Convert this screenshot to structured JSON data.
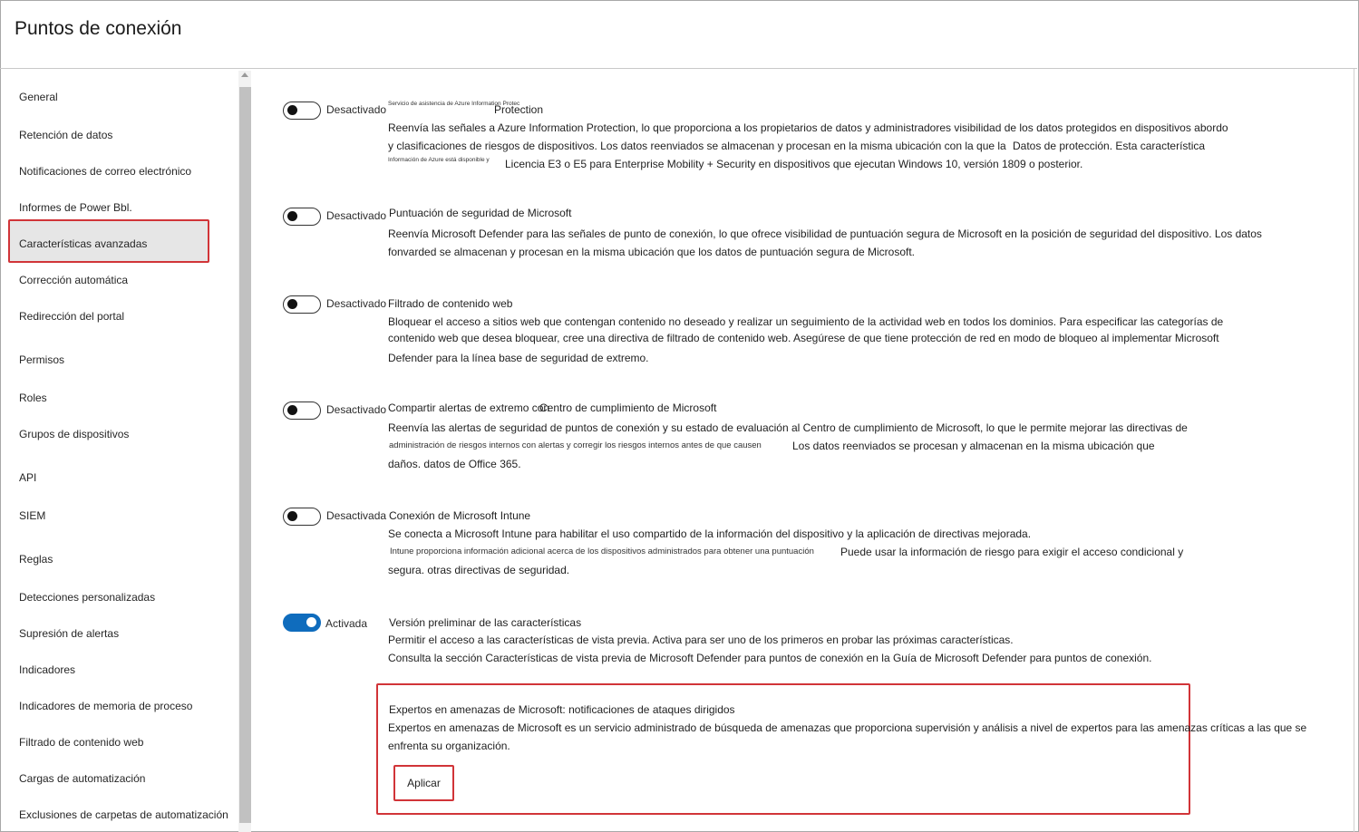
{
  "page": {
    "title": "Puntos de conexión"
  },
  "sidebar": {
    "items": [
      {
        "label": "General"
      },
      {
        "label": "Retención de datos"
      },
      {
        "label": "Notificaciones de correo electrónico"
      },
      {
        "label": "Informes de Power Bbl."
      },
      {
        "label": "Características avanzadas",
        "selected": true
      },
      {
        "label": "Corrección automática"
      },
      {
        "label": "Redirección del portal"
      },
      {
        "label": "Permisos"
      },
      {
        "label": "Roles"
      },
      {
        "label": "Grupos de dispositivos"
      },
      {
        "label": "API"
      },
      {
        "label": "SIEM"
      },
      {
        "label": "Reglas"
      },
      {
        "label": "Detecciones personalizadas"
      },
      {
        "label": "Supresión de alertas"
      },
      {
        "label": "Indicadores"
      },
      {
        "label": "Indicadores de memoria de proceso"
      },
      {
        "label": "Filtrado de contenido web"
      },
      {
        "label": "Cargas de automatización"
      },
      {
        "label": "Exclusiones de carpetas de automatización"
      }
    ]
  },
  "features": [
    {
      "state": "Desactivado",
      "on": false,
      "tiny_prefix": "Servicio de asistencia de Azure Information Protec",
      "title": "Protection",
      "lines": [
        "Reenvía las señales a Azure Information Protection, lo que proporciona a los propietarios de datos y administradores visibilidad de los datos protegidos en dispositivos abordo",
        "y clasificaciones de riesgos de dispositivos. Los datos reenviados se almacenan y procesan en la misma ubicación con la que la",
        "Datos de protección. Esta característica",
        "Información de Azure está disponible y",
        "Licencia E3 o E5 para Enterprise Mobility + Security en dispositivos que ejecutan Windows 10, versión 1809 o posterior."
      ]
    },
    {
      "state": "Desactivado",
      "on": false,
      "title": "Puntuación de seguridad de Microsoft",
      "lines": [
        "Reenvía Microsoft Defender para las señales de punto de conexión, lo que ofrece visibilidad de puntuación segura de Microsoft en la posición de seguridad del dispositivo. Los datos",
        "fonvarded se almacenan y procesan en la misma ubicación que los datos de puntuación segura de Microsoft."
      ]
    },
    {
      "state": "Desactivado",
      "on": false,
      "title": "Filtrado de contenido web",
      "lines": [
        "Bloquear el acceso a sitios web que contengan contenido no deseado y realizar un seguimiento de la actividad web en todos los dominios. Para especificar las categorías de",
        "contenido web que desea bloquear, cree una directiva de filtrado de contenido web. Asegúrese de que tiene protección de red en modo de bloqueo al implementar Microsoft",
        "Defender para la línea base de seguridad de extremo."
      ]
    },
    {
      "state": "Desactivado",
      "on": false,
      "title": "Compartir alertas de extremo con",
      "title_suffix": "Centro de cumplimiento de Microsoft",
      "lines": [
        "Reenvía las alertas de seguridad de puntos de conexión y su estado de evaluación al Centro de cumplimiento de Microsoft, lo que le permite mejorar las directivas de",
        "administración de riesgos internos con alertas y corregir los riesgos internos antes de que causen",
        "Los datos reenviados se procesan y almacenan en la misma ubicación que",
        "daños. datos de Office 365."
      ]
    },
    {
      "state": "Desactivada",
      "on": false,
      "title": "Conexión de Microsoft Intune",
      "lines": [
        "Se conecta a Microsoft Intune para habilitar el uso compartido de la información del dispositivo y la aplicación de directivas mejorada.",
        "Intune proporciona información adicional acerca de los dispositivos administrados para obtener una puntuación",
        "Puede usar la información de riesgo para exigir el acceso condicional y",
        "segura. otras directivas de seguridad."
      ]
    },
    {
      "state": "Activada",
      "on": true,
      "title": "Versión preliminar de las características",
      "lines": [
        "Permitir el acceso a las características de vista previa. Activa para ser uno de los primeros en probar las próximas características.",
        "Consulta la sección Características de vista previa de Microsoft Defender para puntos de conexión en la Guía de Microsoft Defender para puntos de conexión."
      ]
    }
  ],
  "threat_experts": {
    "title": "Expertos en amenazas de Microsoft: notificaciones de ataques dirigidos",
    "lines": [
      "Expertos en amenazas de Microsoft es un servicio administrado de búsqueda de amenazas que proporciona supervisión y análisis a nivel de expertos para las amenazas críticas a las que se",
      "enfrenta su organización."
    ],
    "apply_label": "Aplicar"
  },
  "colors": {
    "accent": "#0f6cbd",
    "highlight": "#d13438",
    "selected_bg": "#e6e6e6"
  }
}
